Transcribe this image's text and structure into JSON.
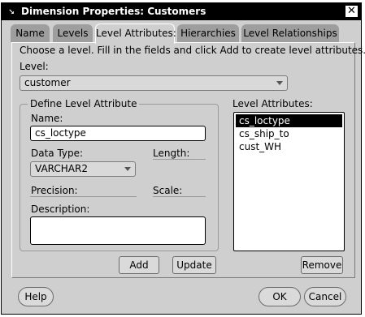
{
  "window": {
    "title": "Dimension Properties: Customers"
  },
  "tabs": [
    {
      "label": "Name"
    },
    {
      "label": "Levels"
    },
    {
      "label": "Level Attributes:"
    },
    {
      "label": "Hierarchies"
    },
    {
      "label": "Level Relationships"
    }
  ],
  "instructions": "Choose a level.  Fill in the fields and click Add to create level attributes.",
  "level": {
    "label": "Level:",
    "value": "customer"
  },
  "define": {
    "group_label": "Define Level Attribute",
    "name_label": "Name:",
    "name_value": "cs_loctype",
    "datatype_label": "Data Type:",
    "datatype_value": "VARCHAR2",
    "length_label": "Length:",
    "precision_label": "Precision:",
    "scale_label": "Scale:",
    "description_label": "Description:",
    "description_value": ""
  },
  "attributes": {
    "label": "Level Attributes:",
    "items": [
      "cs_loctype",
      "cs_ship_to",
      "cust_WH"
    ]
  },
  "buttons": {
    "add": "Add",
    "update": "Update",
    "remove": "Remove",
    "help": "Help",
    "ok": "OK",
    "cancel": "Cancel"
  }
}
